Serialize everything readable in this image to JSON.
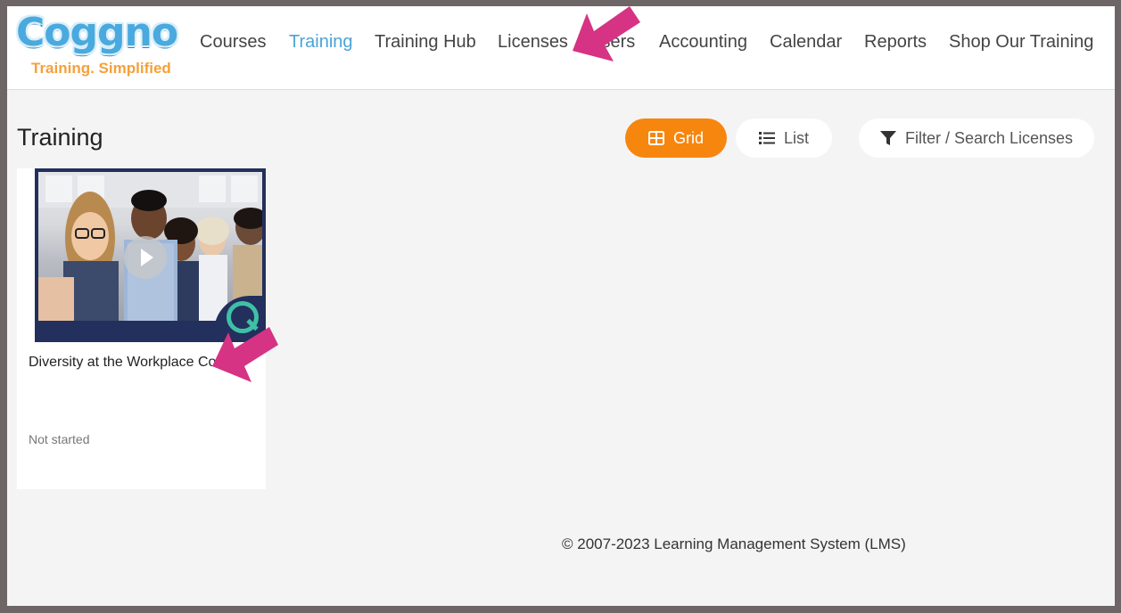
{
  "logo": {
    "name": "Coggno",
    "tagline": "Training. Simplified"
  },
  "nav": {
    "items": [
      {
        "label": "Courses",
        "active": false
      },
      {
        "label": "Training",
        "active": true
      },
      {
        "label": "Training Hub",
        "active": false
      },
      {
        "label": "Licenses",
        "active": false
      },
      {
        "label": "Users",
        "active": false
      },
      {
        "label": "Accounting",
        "active": false
      },
      {
        "label": "Calendar",
        "active": false
      },
      {
        "label": "Reports",
        "active": false
      },
      {
        "label": "Shop Our Training",
        "active": false
      }
    ]
  },
  "page": {
    "title": "Training"
  },
  "view_toggle": {
    "grid_label": "Grid",
    "list_label": "List",
    "selected": "Grid"
  },
  "filter": {
    "label": "Filter / Search Licenses"
  },
  "cards": [
    {
      "title": "Diversity at the Workplace Course",
      "status": "Not started"
    }
  ],
  "footer": {
    "copyright": "© 2007-2023 Learning Management System (LMS)"
  },
  "colors": {
    "accent": "#f7860e",
    "active_nav": "#4aa3d8",
    "annotation_arrow": "#d63384",
    "brand_blue": "#4aa9de",
    "tagline_orange": "#f5a03a"
  }
}
